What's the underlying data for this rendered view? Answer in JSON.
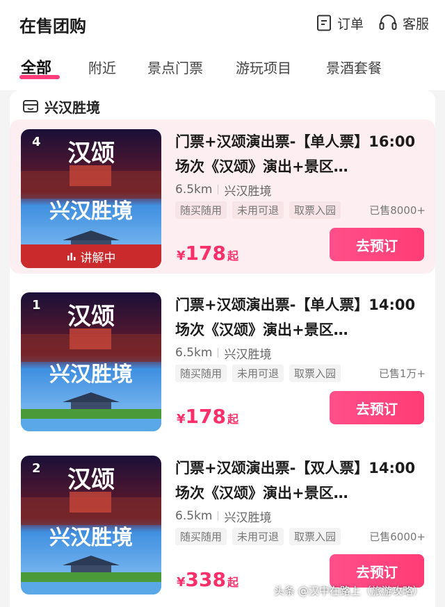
{
  "header": {
    "title": "在售团购",
    "order_label": "订单",
    "service_label": "客服"
  },
  "tabs": [
    {
      "label": "全部",
      "active": true
    },
    {
      "label": "附近"
    },
    {
      "label": "景点门票"
    },
    {
      "label": "游玩项目"
    },
    {
      "label": "景酒套餐"
    }
  ],
  "section": {
    "title": "兴汉胜境"
  },
  "image_text": {
    "top": "汉颂",
    "bottom": "兴汉胜境"
  },
  "products": [
    {
      "rank": "4",
      "badge": "讲解中",
      "name": "门票+汉颂演出票-【单人票】16:00场次《汉颂》演出+景区…",
      "distance": "6.5km",
      "venue": "兴汉胜境",
      "tags": [
        "随买随用",
        "未用可退",
        "取票入园"
      ],
      "sold": "已售8000+",
      "currency": "¥",
      "price": "178",
      "price_suffix": "起",
      "button": "去预订"
    },
    {
      "rank": "1",
      "name": "门票+汉颂演出票-【单人票】14:00场次《汉颂》演出+景区…",
      "distance": "6.5km",
      "venue": "兴汉胜境",
      "tags": [
        "随买随用",
        "未用可退",
        "取票入园"
      ],
      "sold": "已售1万+",
      "currency": "¥",
      "price": "178",
      "price_suffix": "起",
      "button": "去预订"
    },
    {
      "rank": "2",
      "name": "门票+汉颂演出票-【双人票】14:00场次《汉颂》演出+景区…",
      "distance": "6.5km",
      "venue": "兴汉胜境",
      "tags": [
        "随买随用",
        "未用可退",
        "取票入园"
      ],
      "sold": "已售6000+",
      "currency": "¥",
      "price": "338",
      "price_suffix": "起",
      "button": "去预订"
    }
  ],
  "watermark": "头条 @汉中在路上（旅游攻略）",
  "colors": {
    "accent": "#ff3b7c",
    "price": "#ff2f6a",
    "highlight_bg": "#fdeff1"
  }
}
